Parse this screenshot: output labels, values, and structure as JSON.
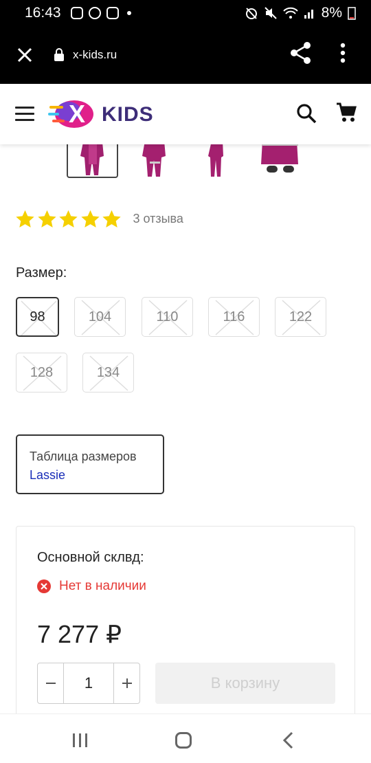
{
  "status_bar": {
    "time": "16:43",
    "battery": "8%"
  },
  "browser": {
    "url": "x-kids.ru"
  },
  "site": {
    "logo_text": "KIDS",
    "brand_color": "#3d2d78"
  },
  "product": {
    "rating": 5,
    "reviews_label": "3 отзыва",
    "star_color": "#f5d000",
    "size_label": "Размер:",
    "sizes": [
      {
        "label": "98",
        "selected": true,
        "available": false
      },
      {
        "label": "104",
        "selected": false,
        "available": false
      },
      {
        "label": "110",
        "selected": false,
        "available": false
      },
      {
        "label": "116",
        "selected": false,
        "available": false
      },
      {
        "label": "122",
        "selected": false,
        "available": false
      },
      {
        "label": "128",
        "selected": false,
        "available": false
      },
      {
        "label": "134",
        "selected": false,
        "available": false
      }
    ],
    "size_table": {
      "title": "Таблица размеров",
      "brand": "Lassie"
    },
    "stock": {
      "title": "Основной склвд:",
      "status": "Нет в наличии",
      "status_color": "#e53935"
    },
    "price": "7 277 ₽",
    "quantity": "1",
    "add_to_cart": "В корзину"
  }
}
